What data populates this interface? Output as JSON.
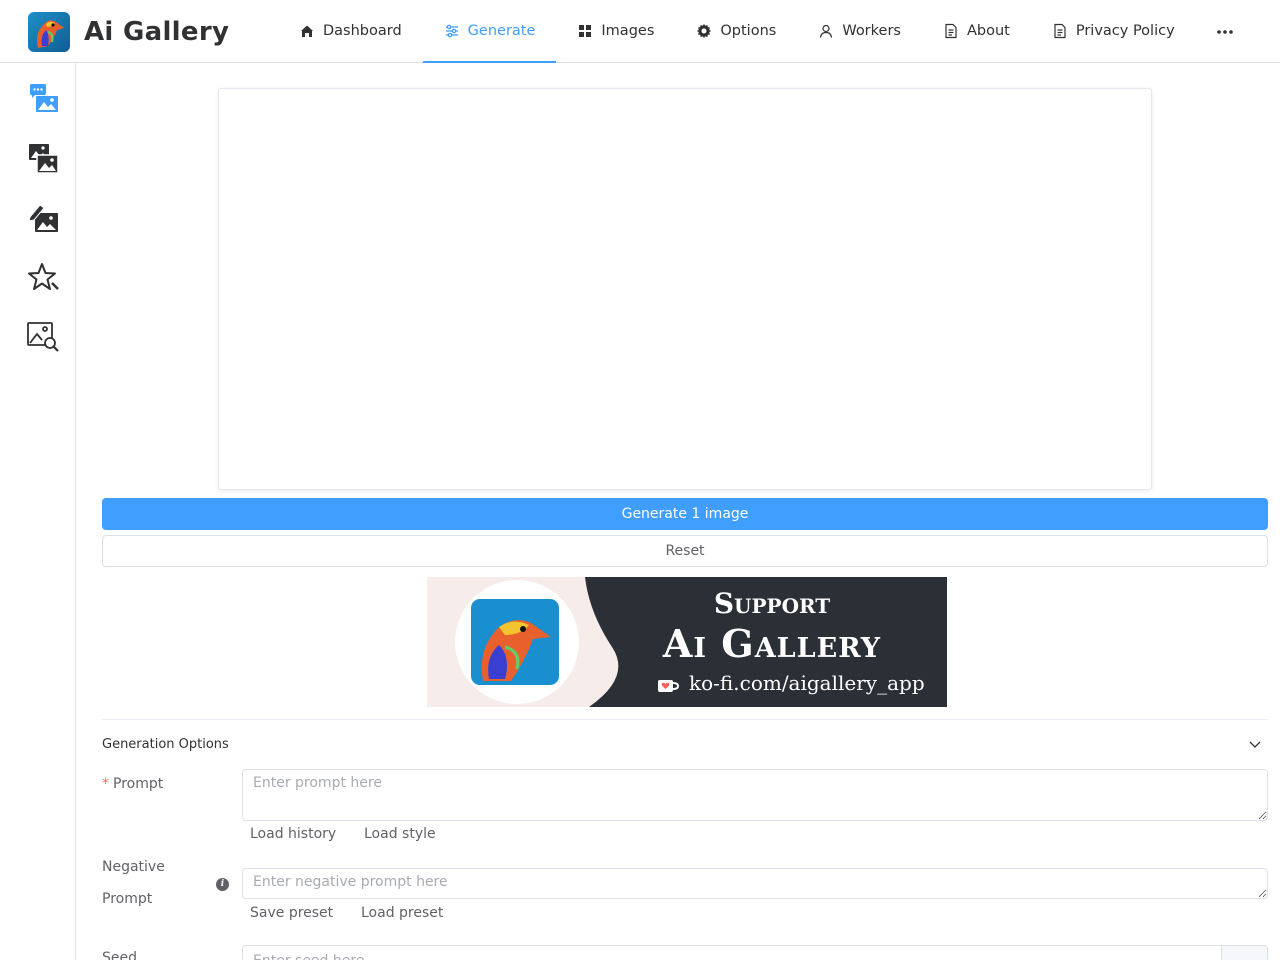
{
  "app": {
    "title": "Ai Gallery"
  },
  "nav": {
    "dashboard": "Dashboard",
    "generate": "Generate",
    "images": "Images",
    "options": "Options",
    "workers": "Workers",
    "about": "About",
    "privacy": "Privacy Policy",
    "active": "Generate"
  },
  "sidebar": {
    "items": [
      "text-to-image-icon",
      "image-to-image-icon",
      "inpainting-icon",
      "favorite-star-icon",
      "image-search-icon"
    ]
  },
  "actions": {
    "generate_label": "Generate 1 image",
    "reset_label": "Reset"
  },
  "banner": {
    "line1": "Support",
    "line2": "Ai Gallery",
    "url": "ko-fi.com/aigallery_app"
  },
  "options": {
    "section_title": "Generation Options",
    "prompt_label": "Prompt",
    "prompt_placeholder": "Enter prompt here",
    "load_history": "Load history",
    "load_style": "Load style",
    "negative_label_1": "Negative",
    "negative_label_2": "Prompt",
    "negative_placeholder": "Enter negative prompt here",
    "save_preset": "Save preset",
    "load_preset": "Load preset",
    "seed_label": "Seed",
    "seed_placeholder": "Enter seed here"
  },
  "colors": {
    "accent": "#409eff",
    "required": "#f56c6c",
    "banner_dark": "#2b2f36"
  }
}
